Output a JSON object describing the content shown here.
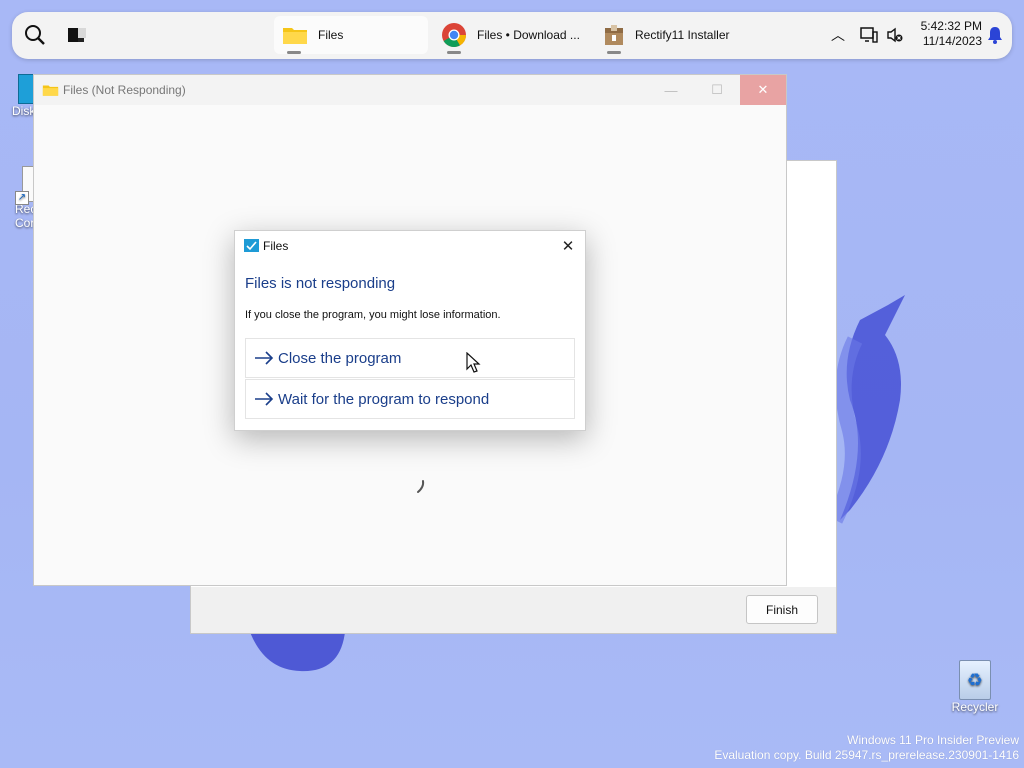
{
  "taskbar": {
    "apps": [
      {
        "label": "Files",
        "active": true
      },
      {
        "label": "Files • Download ...",
        "active": false
      },
      {
        "label": "Rectify11 Installer",
        "active": false
      }
    ],
    "tray": {
      "time": "5:42:32 PM",
      "date": "11/14/2023"
    }
  },
  "desktop": {
    "icons": [
      {
        "label": "Disk"
      },
      {
        "label": "Rec\nCor"
      },
      {
        "label": "Recycler"
      }
    ]
  },
  "background_window": {
    "finish_label": "Finish"
  },
  "main_window": {
    "title": "Files (Not Responding)"
  },
  "dialog": {
    "title": "Files",
    "heading": "Files is not responding",
    "message": "If you close the program, you might lose information.",
    "options": [
      {
        "label": "Close the program"
      },
      {
        "label": "Wait for the program to respond"
      }
    ]
  },
  "watermark": {
    "line1": "Windows 11 Pro Insider Preview",
    "line2": "Evaluation copy. Build 25947.rs_prerelease.230901-1416"
  }
}
